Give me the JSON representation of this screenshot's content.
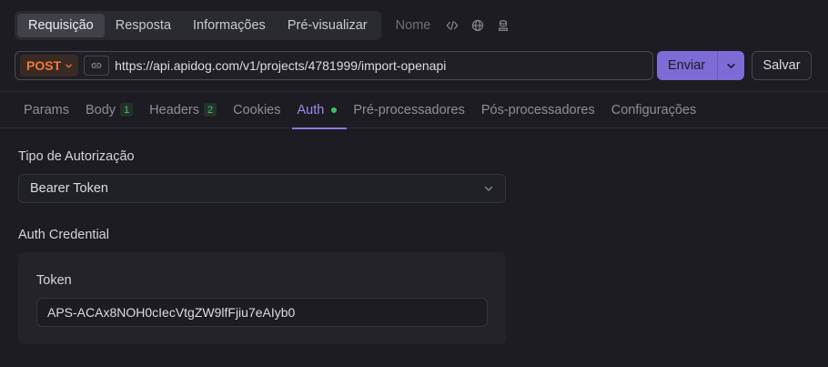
{
  "top_tabs": [
    {
      "label": "Requisição",
      "active": true
    },
    {
      "label": "Resposta",
      "active": false
    },
    {
      "label": "Informações",
      "active": false
    },
    {
      "label": "Pré-visualizar",
      "active": false
    }
  ],
  "meta": {
    "name_placeholder": "Nome",
    "icons": [
      "code-icon",
      "globe-icon",
      "server-icon"
    ]
  },
  "request": {
    "method": "POST",
    "url": "https://api.apidog.com/v1/projects/4781999/import-openapi",
    "send_label": "Enviar",
    "save_label": "Salvar"
  },
  "sub_tabs": [
    {
      "label": "Params",
      "badge": "",
      "active": false
    },
    {
      "label": "Body",
      "badge": "1",
      "active": false
    },
    {
      "label": "Headers",
      "badge": "2",
      "active": false
    },
    {
      "label": "Cookies",
      "badge": "",
      "active": false
    },
    {
      "label": "Auth",
      "badge": "",
      "active": true
    },
    {
      "label": "Pré-processadores",
      "badge": "",
      "active": false
    },
    {
      "label": "Pós-processadores",
      "badge": "",
      "active": false
    },
    {
      "label": "Configurações",
      "badge": "",
      "active": false
    }
  ],
  "auth": {
    "type_label": "Tipo de Autorização",
    "type_value": "Bearer Token",
    "credential_label": "Auth Credential",
    "token_label": "Token",
    "token_value": "APS-ACAx8NOH0cIecVtgZW9lfFjiu7eAIyb0"
  },
  "colors": {
    "accent": "#8a77e4",
    "method": "#f07a3a",
    "status_dot": "#3bc16a"
  }
}
